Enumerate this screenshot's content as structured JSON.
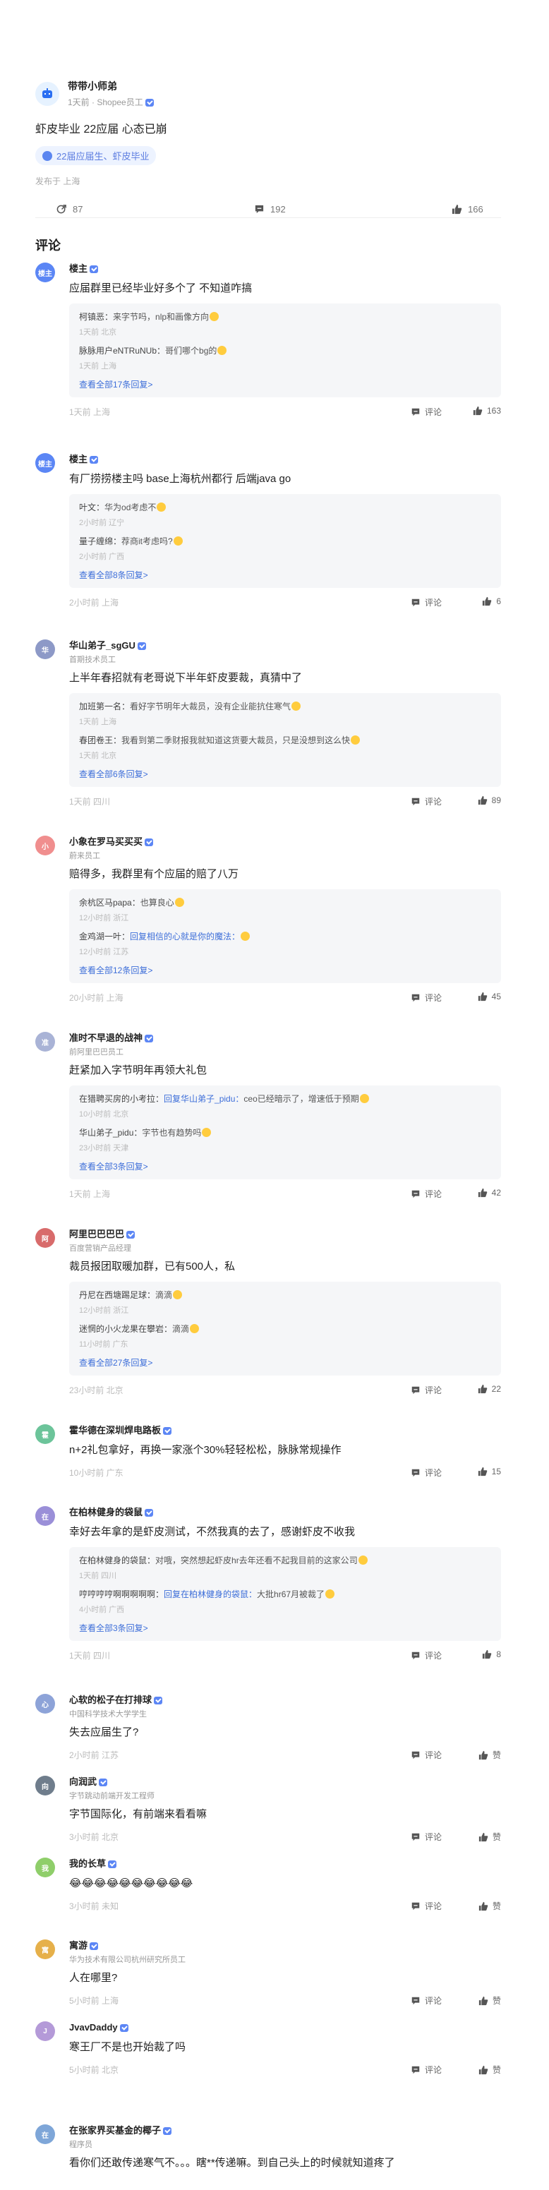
{
  "post": {
    "author_name": "带带小师弟",
    "author_sub": "1天前 · Shopee员工",
    "content": "虾皮毕业 22应届 心态已崩",
    "tag": "22届应届生、虾皮毕业",
    "location": "发布于 上海",
    "share_count": "87",
    "comment_count": "192",
    "like_count": "166"
  },
  "section_title": "评论",
  "comments": [
    {
      "avatar": "楼主",
      "avatar_color": "#5b86f5",
      "name": "楼主",
      "title": "",
      "text": "应届群里已经毕业好多个了 不知道咋搞",
      "replies": [
        {
          "name": "柯镇恶：",
          "link": "",
          "text": "来字节吗，nlp和画像方向",
          "meta": "1天前 北京"
        },
        {
          "name": "脉脉用户eNTRuNUb：",
          "link": "",
          "text": "哥们哪个bg的",
          "meta": "1天前 上海"
        }
      ],
      "more": "查看全部17条回复>",
      "meta": "1天前 上海",
      "comment_label": "评论",
      "likes": "163"
    },
    {
      "avatar": "楼主",
      "avatar_color": "#5b86f5",
      "name": "楼主",
      "title": "",
      "text": "有厂捞捞楼主吗 base上海杭州都行 后端java go",
      "replies": [
        {
          "name": "叶文：",
          "link": "",
          "text": "华为od考虑不",
          "meta": "2小时前 辽宁"
        },
        {
          "name": "量子缠绵：",
          "link": "",
          "text": "荐商it考虑吗?",
          "meta": "2小时前 广西"
        }
      ],
      "more": "查看全部8条回复>",
      "meta": "2小时前 上海",
      "comment_label": "评论",
      "likes": "6"
    },
    {
      "avatar": "华",
      "avatar_color": "#8d99c7",
      "name": "华山弟子_sgGU",
      "title": "首期技术员工",
      "text": "上半年春招就有老哥说下半年虾皮要裁，真猜中了",
      "replies": [
        {
          "name": "加班第一名：",
          "link": "",
          "text": "看好字节明年大裁员，没有企业能抗住寒气",
          "meta": "1天前 上海"
        },
        {
          "name": "春团卷王：",
          "link": "",
          "text": "我看到第二季财报我就知道这货要大裁员，只是没想到这么快",
          "meta": "1天前 北京"
        }
      ],
      "more": "查看全部6条回复>",
      "meta": "1天前 四川",
      "comment_label": "评论",
      "likes": "89"
    },
    {
      "avatar": "小",
      "avatar_color": "#f08e8e",
      "name": "小象在罗马买买买",
      "title": "蔚来员工",
      "text": "赔得多，我群里有个应届的赔了八万",
      "replies": [
        {
          "name": "余杭区马papa：",
          "link": "",
          "text": "也算良心",
          "meta": "12小时前 浙江"
        },
        {
          "name": "金鸡湖一叶：",
          "link": "回复相信的心就是你的魔法：",
          "text": "",
          "meta": "12小时前 江苏"
        }
      ],
      "more": "查看全部12条回复>",
      "meta": "20小时前 上海",
      "comment_label": "评论",
      "likes": "45"
    },
    {
      "avatar": "准",
      "avatar_color": "#a9b3d6",
      "name": "准时不早退的战神",
      "title": "前阿里巴巴员工",
      "text": "赶紧加入字节明年再领大礼包",
      "replies": [
        {
          "name": "在猎聘买房的小考拉：",
          "link": "回复华山弟子_pidu：",
          "text": "ceo已经暗示了，增速低于预期",
          "meta": "10小时前 北京"
        },
        {
          "name": "华山弟子_pidu：",
          "link": "",
          "text": "字节也有趋势吗",
          "meta": "23小时前 天津"
        }
      ],
      "more": "查看全部3条回复>",
      "meta": "1天前 上海",
      "comment_label": "评论",
      "likes": "42"
    },
    {
      "avatar": "阿",
      "avatar_color": "#d86b6b",
      "name": "阿里巴巴巴巴",
      "title": "百度营销产品经理",
      "text": "裁员报团取暖加群，已有500人，私",
      "replies": [
        {
          "name": "丹尼在西塘踢足球：",
          "link": "",
          "text": "滴滴",
          "meta": "12小时前 浙江"
        },
        {
          "name": "迷惘的小火龙果在攀岩：",
          "link": "",
          "text": "滴滴",
          "meta": "11小时前 广东"
        }
      ],
      "more": "查看全部27条回复>",
      "meta": "23小时前 北京",
      "comment_label": "评论",
      "likes": "22"
    },
    {
      "avatar": "霍",
      "avatar_color": "#6cc49a",
      "name": "霍华德在深圳焊电路板",
      "title": "",
      "text": "n+2礼包拿好，再换一家涨个30%轻轻松松，脉脉常规操作",
      "replies": [],
      "more": "",
      "meta": "10小时前 广东",
      "comment_label": "评论",
      "likes": "15"
    },
    {
      "avatar": "在",
      "avatar_color": "#9a8fd8",
      "name": "在柏林健身的袋鼠",
      "title": "",
      "text": "幸好去年拿的是虾皮测试，不然我真的去了，感谢虾皮不收我",
      "replies": [
        {
          "name": "在柏林健身的袋鼠：",
          "link": "",
          "text": "对哦，突然想起虾皮hr去年还看不起我目前的这家公司",
          "meta": "1天前 四川"
        },
        {
          "name": "哼哼哼哼啊啊啊啊啊：",
          "link": "回复在柏林健身的袋鼠：",
          "text": "大批hr67月被裁了",
          "meta": "4小时前 广西"
        }
      ],
      "more": "查看全部3条回复>",
      "meta": "1天前 四川",
      "comment_label": "评论",
      "likes": "8"
    },
    {
      "avatar": "心",
      "avatar_color": "#8da3d8",
      "name": "心软的松子在打排球",
      "title": "中国科学技术大学学生",
      "text": "失去应届生了?",
      "replies": [],
      "more": "",
      "meta": "2小时前 江苏",
      "comment_label": "评论",
      "likes": "赞"
    },
    {
      "avatar": "向",
      "avatar_color": "#6f7d8c",
      "name": "向润武",
      "title": "字节跳动前端开发工程师",
      "text": "字节国际化，有前端来看看嘛",
      "replies": [],
      "more": "",
      "meta": "3小时前 北京",
      "comment_label": "评论",
      "likes": "赞"
    },
    {
      "avatar": "我",
      "avatar_color": "#8fce6a",
      "name": "我的长草",
      "title": "",
      "text": "😂😂😂😂😂😂😂😂😂😂",
      "replies": [],
      "more": "",
      "meta": "3小时前 未知",
      "comment_label": "评论",
      "likes": "赞"
    },
    {
      "avatar": "寓",
      "avatar_color": "#e6b04a",
      "name": "寓游",
      "title": "华为技术有限公司杭州研究所员工",
      "text": "人在哪里?",
      "replies": [],
      "more": "",
      "meta": "5小时前 上海",
      "comment_label": "评论",
      "likes": "赞"
    },
    {
      "avatar": "J",
      "avatar_color": "#b49ad8",
      "name": "JvavDaddy",
      "title": "",
      "text": "寒王厂不是也开始裁了吗",
      "replies": [],
      "more": "",
      "meta": "5小时前 北京",
      "comment_label": "评论",
      "likes": "赞"
    },
    {
      "avatar": "在",
      "avatar_color": "#7ea6d8",
      "name": "在张家界买基金的椰子",
      "title": "程序员",
      "text": "看你们还敢传递寒气不。。。瞎**传递嘛。到自己头上的时候就知道疼了",
      "replies": [],
      "more": "",
      "meta": "",
      "comment_label": "",
      "likes": ""
    }
  ],
  "colors": {
    "accent": "#3d6ed9",
    "tag_bg": "#edf3ff",
    "reply_bg": "#f5f6f8"
  },
  "icons": [
    "share-icon",
    "comment-icon",
    "like-icon",
    "verified-icon"
  ]
}
